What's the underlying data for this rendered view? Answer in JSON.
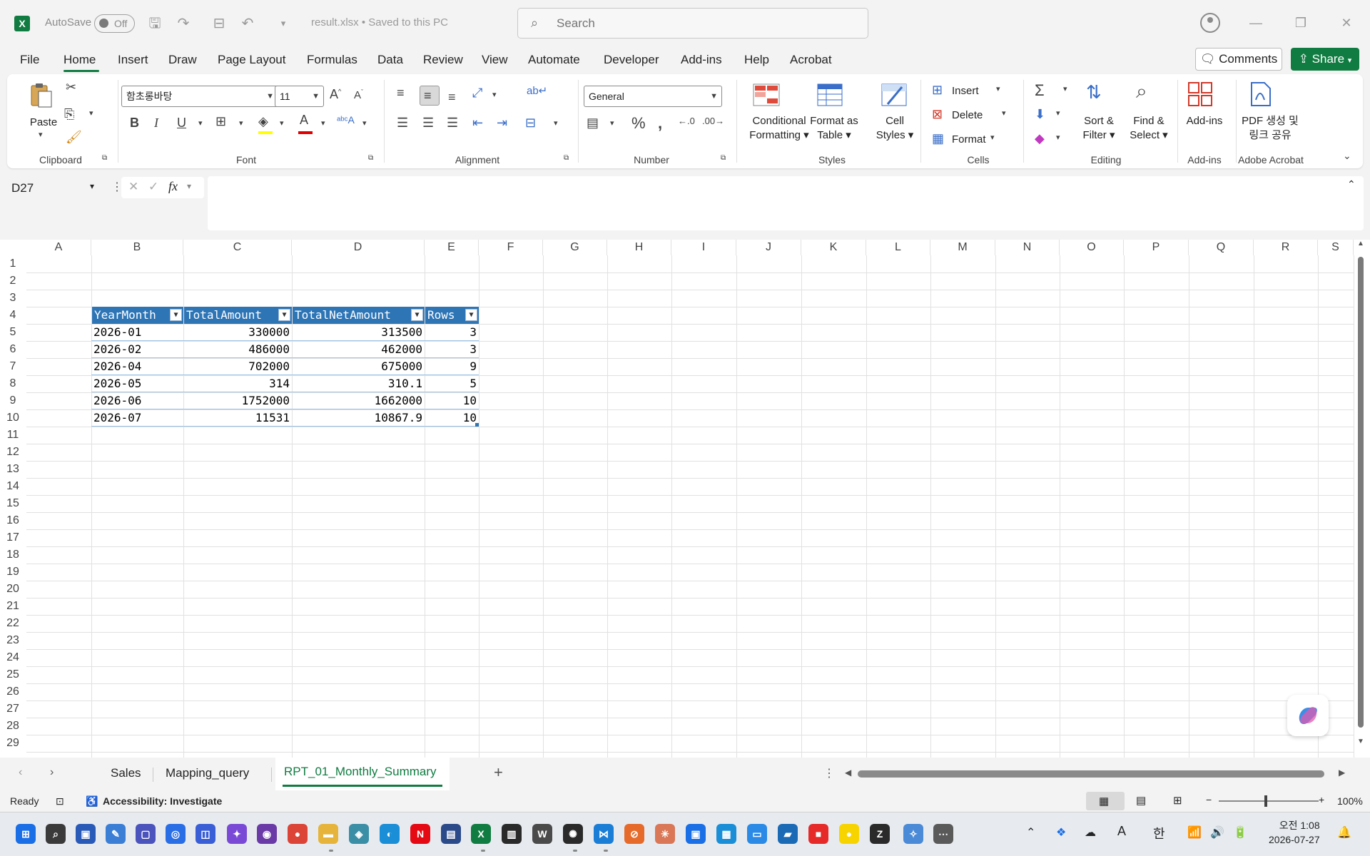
{
  "titlebar": {
    "autosave_label": "AutoSave",
    "autosave_state": "Off",
    "doc_title": "result.xlsx • Saved to this PC",
    "search_placeholder": "Search"
  },
  "menu": {
    "items": [
      "File",
      "Home",
      "Insert",
      "Draw",
      "Page Layout",
      "Formulas",
      "Data",
      "Review",
      "View",
      "Automate",
      "Developer",
      "Add-ins",
      "Help",
      "Acrobat"
    ],
    "active": "Home",
    "comments": "Comments",
    "share": "Share"
  },
  "ribbon": {
    "clipboard": {
      "label": "Clipboard",
      "paste": "Paste"
    },
    "font": {
      "label": "Font",
      "font_name": "함초롱바탕",
      "font_size": "11"
    },
    "alignment": {
      "label": "Alignment"
    },
    "number": {
      "label": "Number",
      "format": "General"
    },
    "styles": {
      "label": "Styles",
      "conditional": "Conditional",
      "formatting": "Formatting",
      "format_as": "Format as",
      "table": "Table",
      "cell": "Cell",
      "cell_styles": "Styles"
    },
    "cells": {
      "label": "Cells",
      "insert": "Insert",
      "delete": "Delete",
      "format": "Format"
    },
    "editing": {
      "label": "Editing",
      "sort": "Sort &",
      "filter": "Filter",
      "find": "Find &",
      "select": "Select"
    },
    "addins": {
      "label": "Add-ins",
      "button": "Add-ins"
    },
    "acrobat": {
      "label": "Adobe Acrobat",
      "line1": "PDF 생성 및",
      "line2": "링크 공유"
    }
  },
  "formula_bar": {
    "name_box": "D27",
    "fx": "fx",
    "value": ""
  },
  "grid": {
    "columns": [
      "A",
      "B",
      "C",
      "D",
      "E",
      "F",
      "G",
      "H",
      "I",
      "J",
      "K",
      "L",
      "M",
      "N",
      "O",
      "P",
      "Q",
      "R",
      "S"
    ],
    "rows": [
      "1",
      "2",
      "3",
      "4",
      "5",
      "6",
      "7",
      "8",
      "9",
      "10",
      "11",
      "12",
      "13",
      "14",
      "15",
      "16",
      "17",
      "18",
      "19",
      "20",
      "21",
      "22",
      "23",
      "24",
      "25",
      "26",
      "27",
      "28",
      "29"
    ],
    "table_headers": [
      "YearMonth",
      "TotalAmount",
      "TotalNetAmount",
      "Rows"
    ],
    "table_rows": [
      [
        "2026-01",
        "330000",
        "313500",
        "3"
      ],
      [
        "2026-02",
        "486000",
        "462000",
        "3"
      ],
      [
        "2026-04",
        "702000",
        "675000",
        "9"
      ],
      [
        "2026-05",
        "314",
        "310.1",
        "5"
      ],
      [
        "2026-06",
        "1752000",
        "1662000",
        "10"
      ],
      [
        "2026-07",
        "11531",
        "10867.9",
        "10"
      ]
    ]
  },
  "sheets": {
    "tabs": [
      "Sales",
      "Mapping_query",
      "RPT_01_Monthly_Summary"
    ],
    "active": "RPT_01_Monthly_Summary"
  },
  "status": {
    "ready": "Ready",
    "accessibility": "Accessibility: Investigate",
    "zoom": "100%"
  },
  "taskbar": {
    "time": "오전 1:08",
    "date": "2026-07-27",
    "lang": "한"
  },
  "colors": {
    "excel_green": "#107c41",
    "table_header": "#2e75b6"
  }
}
